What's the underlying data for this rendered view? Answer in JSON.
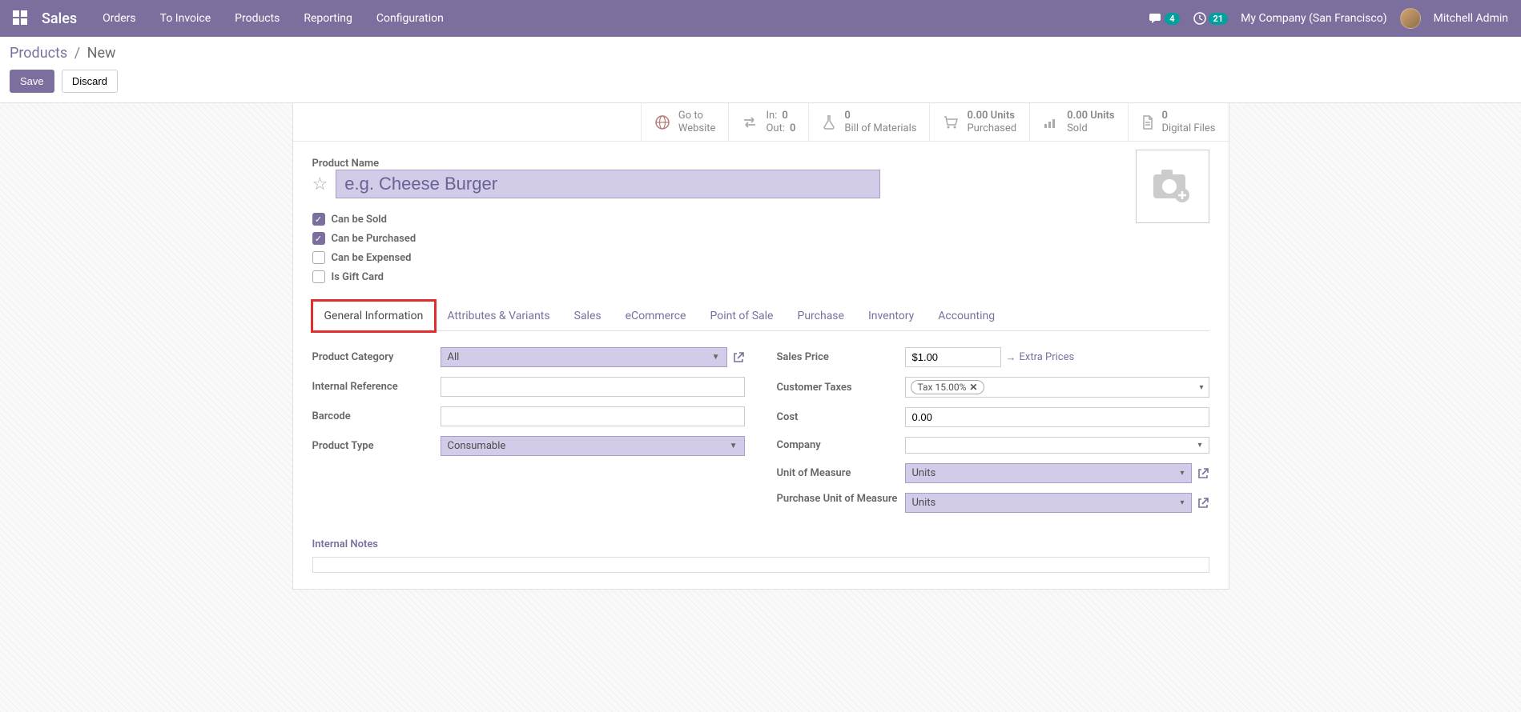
{
  "topnav": {
    "brand": "Sales",
    "menu": [
      "Orders",
      "To Invoice",
      "Products",
      "Reporting",
      "Configuration"
    ],
    "chat_count": "4",
    "clock_count": "21",
    "company": "My Company (San Francisco)",
    "user": "Mitchell Admin"
  },
  "breadcrumb": {
    "root": "Products",
    "current": "New"
  },
  "actions": {
    "save": "Save",
    "discard": "Discard"
  },
  "stats": {
    "website": {
      "line1": "Go to",
      "line2": "Website"
    },
    "inout": {
      "in_label": "In:",
      "in_val": "0",
      "out_label": "Out:",
      "out_val": "0"
    },
    "bom": {
      "val": "0",
      "label": "Bill of Materials"
    },
    "purchased": {
      "val": "0.00 Units",
      "label": "Purchased"
    },
    "sold": {
      "val": "0.00 Units",
      "label": "Sold"
    },
    "digital": {
      "val": "0",
      "label": "Digital Files"
    }
  },
  "product": {
    "name_label": "Product Name",
    "name_placeholder": "e.g. Cheese Burger",
    "checks": {
      "sold": "Can be Sold",
      "purchased": "Can be Purchased",
      "expensed": "Can be Expensed",
      "giftcard": "Is Gift Card"
    }
  },
  "tabs": [
    "General Information",
    "Attributes & Variants",
    "Sales",
    "eCommerce",
    "Point of Sale",
    "Purchase",
    "Inventory",
    "Accounting"
  ],
  "general": {
    "left": {
      "category_label": "Product Category",
      "category_value": "All",
      "ref_label": "Internal Reference",
      "ref_value": "",
      "barcode_label": "Barcode",
      "barcode_value": "",
      "type_label": "Product Type",
      "type_value": "Consumable"
    },
    "right": {
      "price_label": "Sales Price",
      "price_value": "$1.00",
      "extra_prices": "Extra Prices",
      "taxes_label": "Customer Taxes",
      "tax_tag": "Tax 15.00%",
      "cost_label": "Cost",
      "cost_value": "0.00",
      "company_label": "Company",
      "company_value": "",
      "uom_label": "Unit of Measure",
      "uom_value": "Units",
      "puom_label": "Purchase Unit of Measure",
      "puom_value": "Units"
    },
    "notes_label": "Internal Notes"
  }
}
